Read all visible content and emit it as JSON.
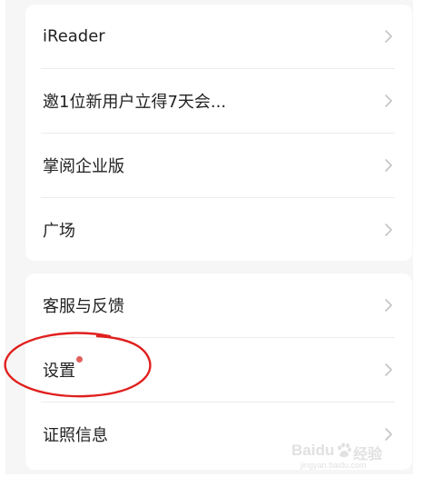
{
  "menu_group_1": {
    "items": [
      {
        "label": "iReader"
      },
      {
        "label": "邀1位新用户立得7天会..."
      },
      {
        "label": "掌阅企业版"
      },
      {
        "label": "广场"
      }
    ]
  },
  "menu_group_2": {
    "items": [
      {
        "label": "客服与反馈"
      },
      {
        "label": "设置",
        "has_badge": true
      },
      {
        "label": "证照信息"
      }
    ]
  },
  "colors": {
    "badge": "#e0605a",
    "annotation_circle": "#e0201e",
    "chevron": "#c4c4c4",
    "background": "#f6f6f6"
  },
  "watermark": {
    "brand": "Baidu",
    "suffix": "经验",
    "url": "jingyan.baidu.com"
  }
}
